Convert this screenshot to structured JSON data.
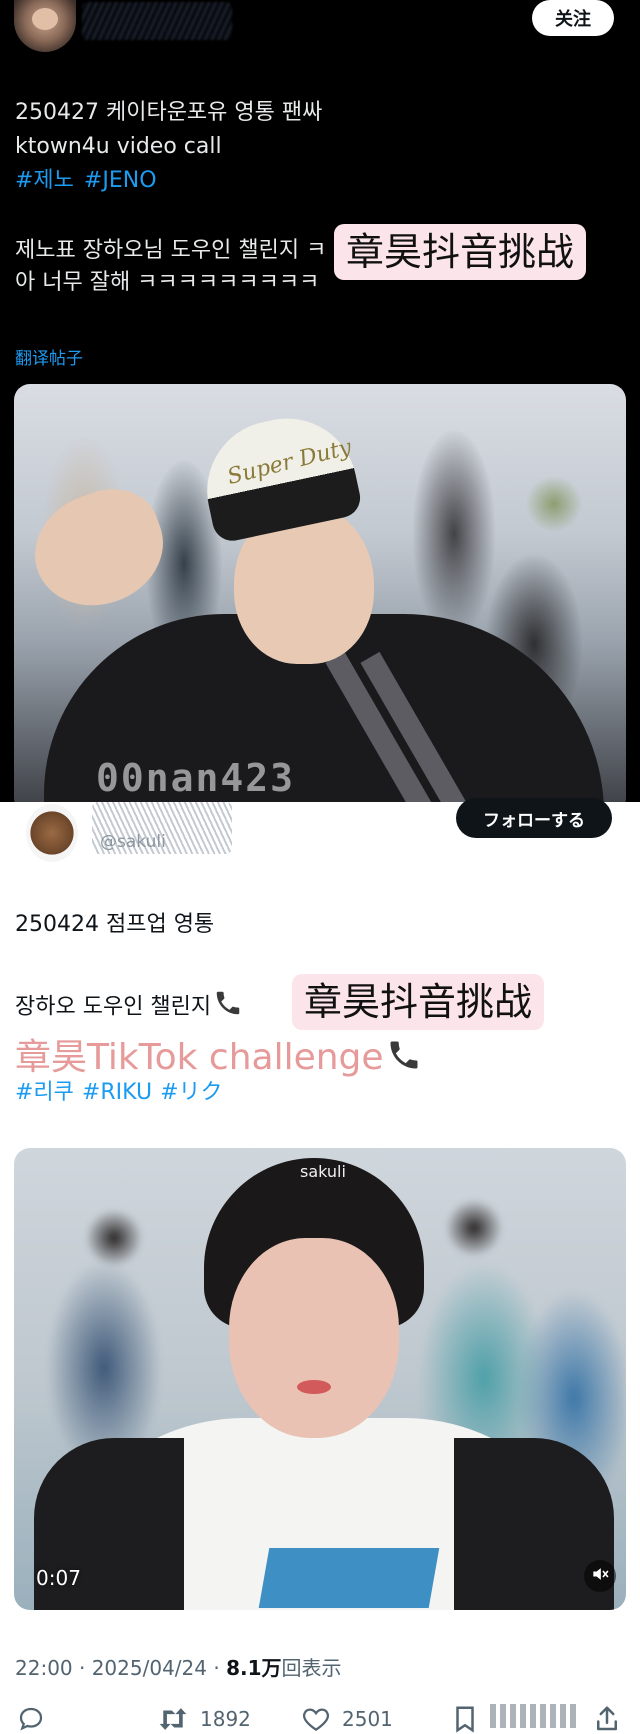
{
  "post1": {
    "follow_label": "关注",
    "lines": [
      "250427 케이타운포유 영통 팬싸",
      "ktown4u video call"
    ],
    "hashtags": [
      "#제노",
      "#JENO"
    ],
    "body_line1": "제노표 장하오님 도우인 챌린지 ㅋ",
    "body_line2": "아 너무 잘해 ㅋㅋㅋㅋㅋㅋㅋㅋㅋ",
    "overlay_label": "章昊抖音挑战",
    "translate_link": "翻译帖子",
    "cap_text": "Super Duty",
    "watermark": "00nan423"
  },
  "post2": {
    "handle": "@sakuli",
    "follow_label": "フォローする",
    "line1": "250424 점프업 영통",
    "line2": "장하오 도우인 챌린지",
    "overlay_label": "章昊抖音挑战",
    "pink_line": "章昊TikTok challenge",
    "hashtags": [
      "#리쿠",
      "#RIKU",
      "#リク"
    ],
    "cap_tag": "sakuli",
    "video_time": "0:07",
    "meta_time": "22:00 · 2025/04/24 · ",
    "meta_views": "8.1万",
    "meta_views_suffix": "回表示",
    "retweets": "1892",
    "likes": "2501"
  },
  "colors": {
    "dark_bg": "#000000",
    "link_blue": "#1d9bf0",
    "overlay_pink": "#fbe4ea",
    "pink_text": "#e69a9a"
  },
  "icons": [
    "reply-icon",
    "retweet-icon",
    "heart-icon",
    "bookmark-icon",
    "share-icon",
    "phone-icon",
    "mute-icon"
  ]
}
